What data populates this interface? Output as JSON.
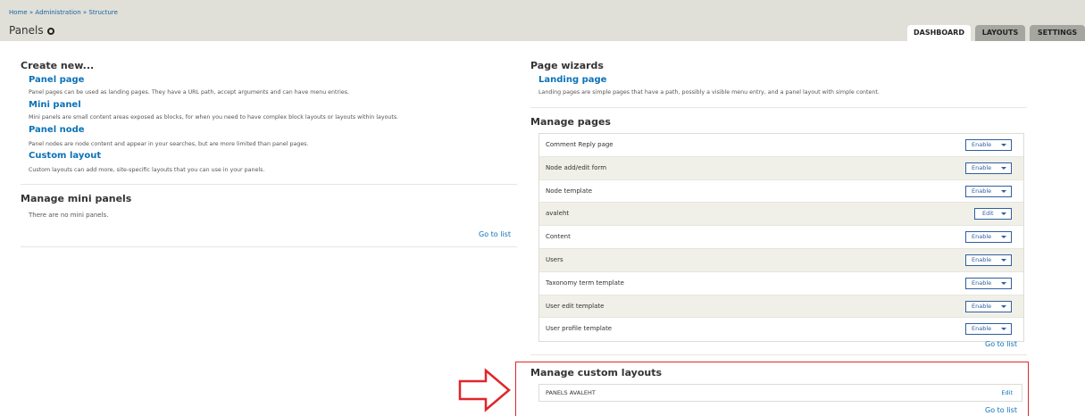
{
  "breadcrumb": {
    "home": "Home",
    "admin": "Administration",
    "structure": "Structure",
    "sep": " » "
  },
  "page_title": "Panels",
  "tabs": [
    {
      "label": "DASHBOARD",
      "active": true
    },
    {
      "label": "LAYOUTS",
      "active": false
    },
    {
      "label": "SETTINGS",
      "active": false
    }
  ],
  "create_new": {
    "title": "Create new...",
    "items": [
      {
        "label": "Panel page",
        "desc": "Panel pages can be used as landing pages. They have a URL path, accept arguments and can have menu entries."
      },
      {
        "label": "Mini panel",
        "desc": "Mini panels are small content areas exposed as blocks, for when you need to have complex block layouts or layouts within layouts."
      },
      {
        "label": "Panel node",
        "desc": "Panel nodes are node content and appear in your searches, but are more limited than panel pages."
      },
      {
        "label": "Custom layout",
        "desc": "Custom layouts can add more, site-specific layouts that you can use in your panels."
      }
    ]
  },
  "mini_panels": {
    "title": "Manage mini panels",
    "empty_text": "There are no mini panels.",
    "go_to_list": "Go to list"
  },
  "wizards": {
    "title": "Page wizards",
    "link": "Landing page",
    "desc": "Landing pages are simple pages that have a path, possibly a visible menu entry, and a panel layout with simple content."
  },
  "manage_pages": {
    "title": "Manage pages",
    "rows": [
      {
        "label": "Comment Reply page",
        "action": "Enable"
      },
      {
        "label": "Node add/edit form",
        "action": "Enable"
      },
      {
        "label": "Node template",
        "action": "Enable"
      },
      {
        "label": "avaleht",
        "action": "Edit"
      },
      {
        "label": "Content",
        "action": "Enable"
      },
      {
        "label": "Users",
        "action": "Enable"
      },
      {
        "label": "Taxonomy term template",
        "action": "Enable"
      },
      {
        "label": "User edit template",
        "action": "Enable"
      },
      {
        "label": "User profile template",
        "action": "Enable"
      }
    ],
    "go_to_list": "Go to list"
  },
  "custom_layouts": {
    "title": "Manage custom layouts",
    "row_label": "PANELS AVALEHT",
    "row_action": "Edit",
    "go_to_list": "Go to list"
  },
  "colors": {
    "accent": "#0b72b8",
    "highlight": "#e0262b"
  }
}
